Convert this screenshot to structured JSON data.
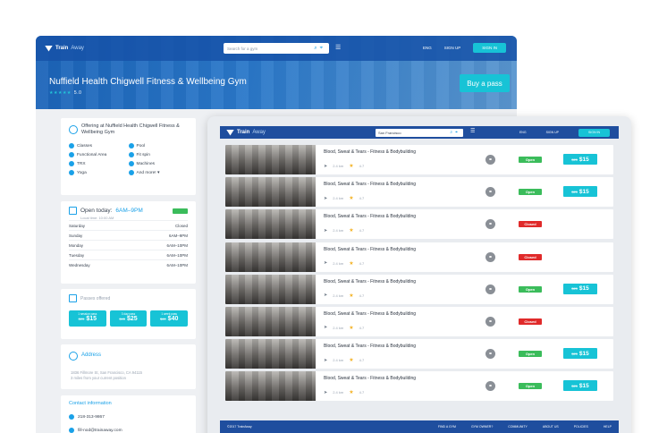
{
  "back": {
    "logo": {
      "brand": "Train",
      "brand_light": "Away"
    },
    "search_placeholder": "Search for a gym",
    "nav": {
      "lang": "ENG",
      "signup": "SIGN UP",
      "signin": "SIGN IN"
    },
    "title": "Nuffield Health Chigwell Fitness & Wellbeing Gym",
    "rating_stars": "★★★★★",
    "rating_value": "5.0",
    "buy_label": "Buy a pass",
    "offer_title": "Offering at Nuffield Health Chigwell Fitness & Wellbeing Gym",
    "amenities": [
      "Classes",
      "Pool",
      "Functional Area",
      "Fit spin",
      "TRX",
      "Machines",
      "Yoga",
      "And more! ▾"
    ],
    "open_label": "Open today:",
    "open_time": "6AM–9PM",
    "local_time": "Local time: 10:00 AM",
    "hours": [
      {
        "day": "Saturday",
        "time": "Closed"
      },
      {
        "day": "Sunday",
        "time": "6AM–9PM"
      },
      {
        "day": "Monday",
        "time": "6AM–10PM"
      },
      {
        "day": "Tuesday",
        "time": "6AM–10PM"
      },
      {
        "day": "Wednesday",
        "time": "6AM–10PM"
      }
    ],
    "passes_label": "Passes offered",
    "passes": [
      {
        "title": "1 session pass",
        "old": "$25",
        "price": "$15"
      },
      {
        "title": "3 day pass",
        "old": "$45",
        "price": "$25"
      },
      {
        "title": "1 week pass",
        "old": "$60",
        "price": "$40"
      }
    ],
    "address_label": "Address",
    "address_line1": "1836 Fillmore St, San Francisco, CA 94115",
    "address_line2": "3 miles from your current position",
    "contact_label": "Contact information",
    "phone": "218-313-9867",
    "email": "fill-nod@trainaway.com"
  },
  "front": {
    "logo": {
      "brand": "Train",
      "brand_light": "Away"
    },
    "search_value": "San Francisco",
    "nav": {
      "lang": "ENG",
      "signup": "SIGN UP",
      "signin": "SIGN IN"
    },
    "results": [
      {
        "name": "Blood, Sweat & Tears - Fitness & Bodybuilding",
        "distance": "2.4 km",
        "rating": "4.7",
        "status": "Open",
        "old": "$25",
        "price": "$15"
      },
      {
        "name": "Blood, Sweat & Tears - Fitness & Bodybuilding",
        "distance": "2.4 km",
        "rating": "4.7",
        "status": "Open",
        "old": "$25",
        "price": "$15"
      },
      {
        "name": "Blood, Sweat & Tears - Fitness & Bodybuilding",
        "distance": "2.4 km",
        "rating": "4.7",
        "status": "Closed",
        "old": "",
        "price": ""
      },
      {
        "name": "Blood, Sweat & Tears - Fitness & Bodybuilding",
        "distance": "2.4 km",
        "rating": "4.7",
        "status": "Closed",
        "old": "",
        "price": ""
      },
      {
        "name": "Blood, Sweat & Tears - Fitness & Bodybuilding",
        "distance": "2.4 km",
        "rating": "4.7",
        "status": "Open",
        "old": "$25",
        "price": "$15"
      },
      {
        "name": "Blood, Sweat & Tears - Fitness & Bodybuilding",
        "distance": "2.4 km",
        "rating": "4.7",
        "status": "Closed",
        "old": "",
        "price": ""
      },
      {
        "name": "Blood, Sweat & Tears - Fitness & Bodybuilding",
        "distance": "2.4 km",
        "rating": "4.7",
        "status": "Open",
        "old": "$25",
        "price": "$15"
      },
      {
        "name": "Blood, Sweat & Tears - Fitness & Bodybuilding",
        "distance": "2.4 km",
        "rating": "4.7",
        "status": "Open",
        "old": "$25",
        "price": "$15"
      }
    ],
    "footer": {
      "copyright": "©2017 TrainAway",
      "links": [
        "FIND A GYM",
        "GYM OWNER?",
        "COMMUNITY",
        "ABOUT US",
        "POLICIES",
        "HELP"
      ]
    }
  },
  "colors": {
    "brand_blue": "#1f4e9e",
    "accent_cyan": "#17c3d6",
    "open_green": "#3bbc5b",
    "closed_red": "#e02a2a"
  }
}
